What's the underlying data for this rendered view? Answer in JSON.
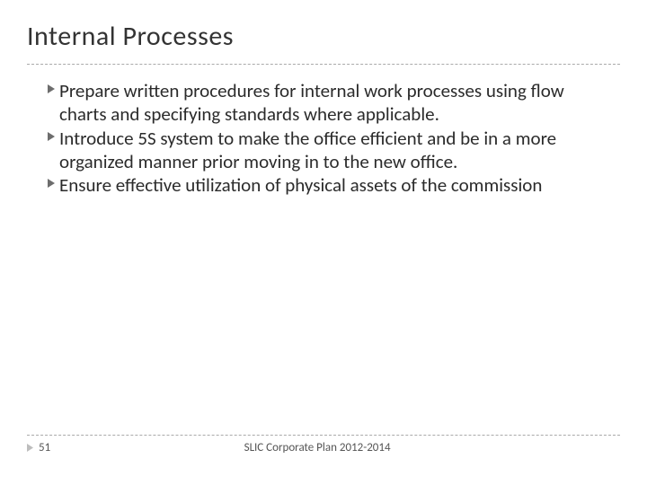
{
  "title": "Internal Processes",
  "bullets": [
    "Prepare written procedures for internal work processes using flow charts and specifying standards where applicable.",
    "Introduce 5S system to make the office efficient and be in a more organized manner prior moving in to the new office.",
    "Ensure effective utilization of physical assets of the commission"
  ],
  "footer": {
    "page_number": "51",
    "text": "SLIC Corporate Plan 2012-2014"
  }
}
